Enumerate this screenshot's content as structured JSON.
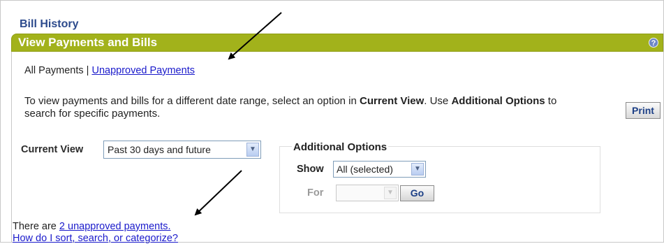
{
  "bill_history": {
    "title": "Bill History"
  },
  "header": {
    "title": "View Payments and Bills",
    "help_icon": "?"
  },
  "filter_links": {
    "all_payments": "All Payments",
    "separator": "|",
    "unapproved_payments": "Unapproved Payments"
  },
  "instructions": {
    "part1": "To view payments and bills for a different date range, select an option in ",
    "current_view": "Current View",
    "part2": ". Use ",
    "additional_options": "Additional Options",
    "part3": " to search for specific payments."
  },
  "print_button": "Print",
  "current_view": {
    "label": "Current View",
    "selected": "Past 30 days and future"
  },
  "additional_options": {
    "title": "Additional Options",
    "show_label": "Show",
    "show_selected": "All (selected)",
    "for_label": "For",
    "for_selected": "",
    "go_button": "Go"
  },
  "status": {
    "prefix": "There are ",
    "link": "2 unapproved payments."
  },
  "help_link": "How do I sort, search, or categorize?",
  "icons": {
    "dropdown": "chevron-down-icon",
    "help": "help-icon",
    "annotation": "arrow-icon"
  },
  "colors": {
    "header_bar": "#a2b21b",
    "link": "#1a1acb",
    "title": "#2c4a8c"
  }
}
